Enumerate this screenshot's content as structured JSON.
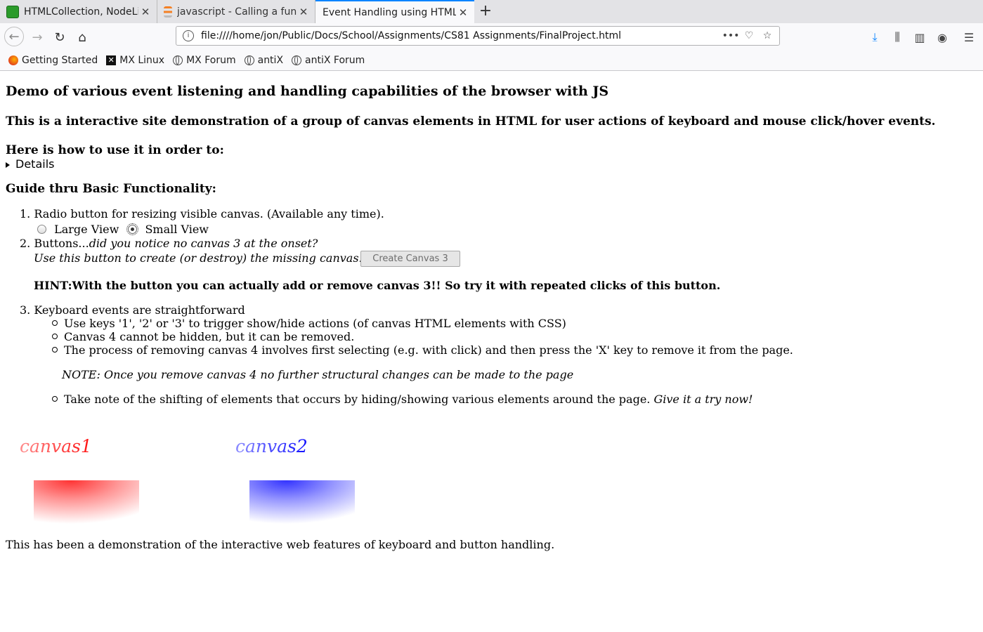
{
  "tabs": [
    {
      "title": "HTMLCollection, NodeLis",
      "favicon_color": "#2b9b2b"
    },
    {
      "title": "javascript - Calling a fun",
      "favicon_color": "#f48024"
    },
    {
      "title": "Event Handling using HTML",
      "favicon_color": "",
      "active": true
    }
  ],
  "navbar": {
    "url": "file:////home/jon/Public/Docs/School/Assignments/CS81 Assignments/FinalProject.html",
    "more_label": "•••"
  },
  "bookmarks": [
    {
      "label": "Getting Started",
      "icon": "firefox-icon"
    },
    {
      "label": "MX Linux",
      "icon": "mx-icon"
    },
    {
      "label": "MX Forum",
      "icon": "globe-icon"
    },
    {
      "label": "antiX",
      "icon": "globe-icon"
    },
    {
      "label": "antiX Forum",
      "icon": "globe-icon"
    }
  ],
  "page": {
    "heading": "Demo of various event listening and handling capabilities of the browser with JS",
    "subheading": "This is a interactive site demonstration of a group of canvas elements in HTML for user actions of keyboard and mouse click/hover events.",
    "howto": "Here is how to use it in order to:",
    "details_label": "Details",
    "guide_heading": "Guide thru Basic Functionality:",
    "item1": "Radio button for resizing visible canvas. (Available any time).",
    "radio_large": "Large View",
    "radio_small": "Small View",
    "item2_prefix": "Buttons...",
    "item2_italic": "did you notice no canvas 3 at the onset?",
    "item2_line2": "Use this button to create (or destroy) the missing canvas.",
    "create_button": "Create Canvas 3",
    "hint": "HINT:With the button you can actually add or remove canvas 3!! So try it with repeated clicks of this button.",
    "item3": "Keyboard events are straightforward",
    "sub1": "Use keys '1', '2' or '3' to trigger show/hide actions (of canvas HTML elements with CSS)",
    "sub2": "Canvas 4 cannot be hidden, but it can be removed.",
    "sub3": "The process of removing canvas 4 involves first selecting (e.g. with click) and then press the 'X' key to remove it from the page.",
    "note": "NOTE: Once you remove canvas 4 no further structural changes can be made to the page",
    "sub4_plain": "Take note of the shifting of elements that occurs by hiding/showing various elements around the page.",
    "sub4_italic": "Give it a try now!",
    "canvas1_label": "canvas1",
    "canvas2_label": "canvas2",
    "footer": "This has been a demonstration of the interactive web features of keyboard and button handling."
  },
  "colors": {
    "accent": "#0a84ff",
    "canvas1": "#ff2222",
    "canvas2": "#2222ff"
  }
}
